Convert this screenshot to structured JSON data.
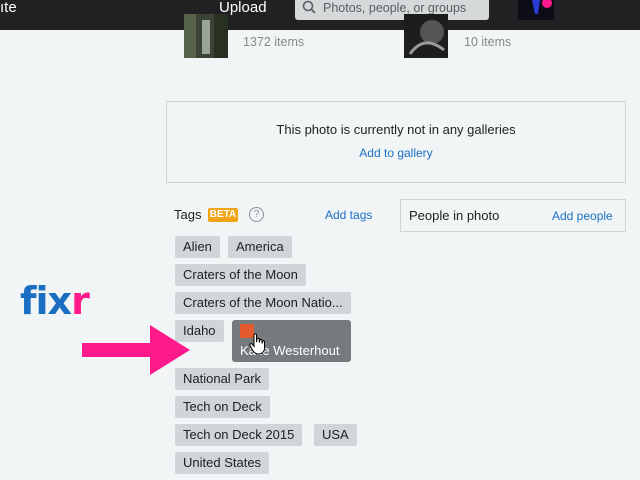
{
  "nav": {
    "fragment": "ıte",
    "upload": "Upload",
    "search_placeholder": "Photos, people, or groups"
  },
  "albums": [
    {
      "count": "1372 items"
    },
    {
      "count": "10 items"
    }
  ],
  "galleries": {
    "message": "This photo is currently not in any galleries",
    "add_link": "Add to gallery"
  },
  "tags": {
    "heading": "Tags",
    "beta": "BETA",
    "help": "?",
    "add_link": "Add tags",
    "items": [
      "Alien",
      "America",
      "Craters of the Moon",
      "Craters of the Moon Natio...",
      "Idaho",
      "National Park",
      "Tech on Deck",
      "Tech on Deck 2015",
      "USA",
      "United States"
    ]
  },
  "people": {
    "heading": "People in photo",
    "add_link": "Add people"
  },
  "tooltip": {
    "name": "Katie Westerhout"
  },
  "overlay": {
    "logo_left": "fix",
    "logo_right": "r"
  },
  "colors": {
    "topbar": "#212124",
    "link": "#1a6fc2",
    "beta": "#f1a416",
    "arrow": "#ff1a8c",
    "tag_bg": "#cfd5d8",
    "tooltip_bg": "#757a7d"
  }
}
